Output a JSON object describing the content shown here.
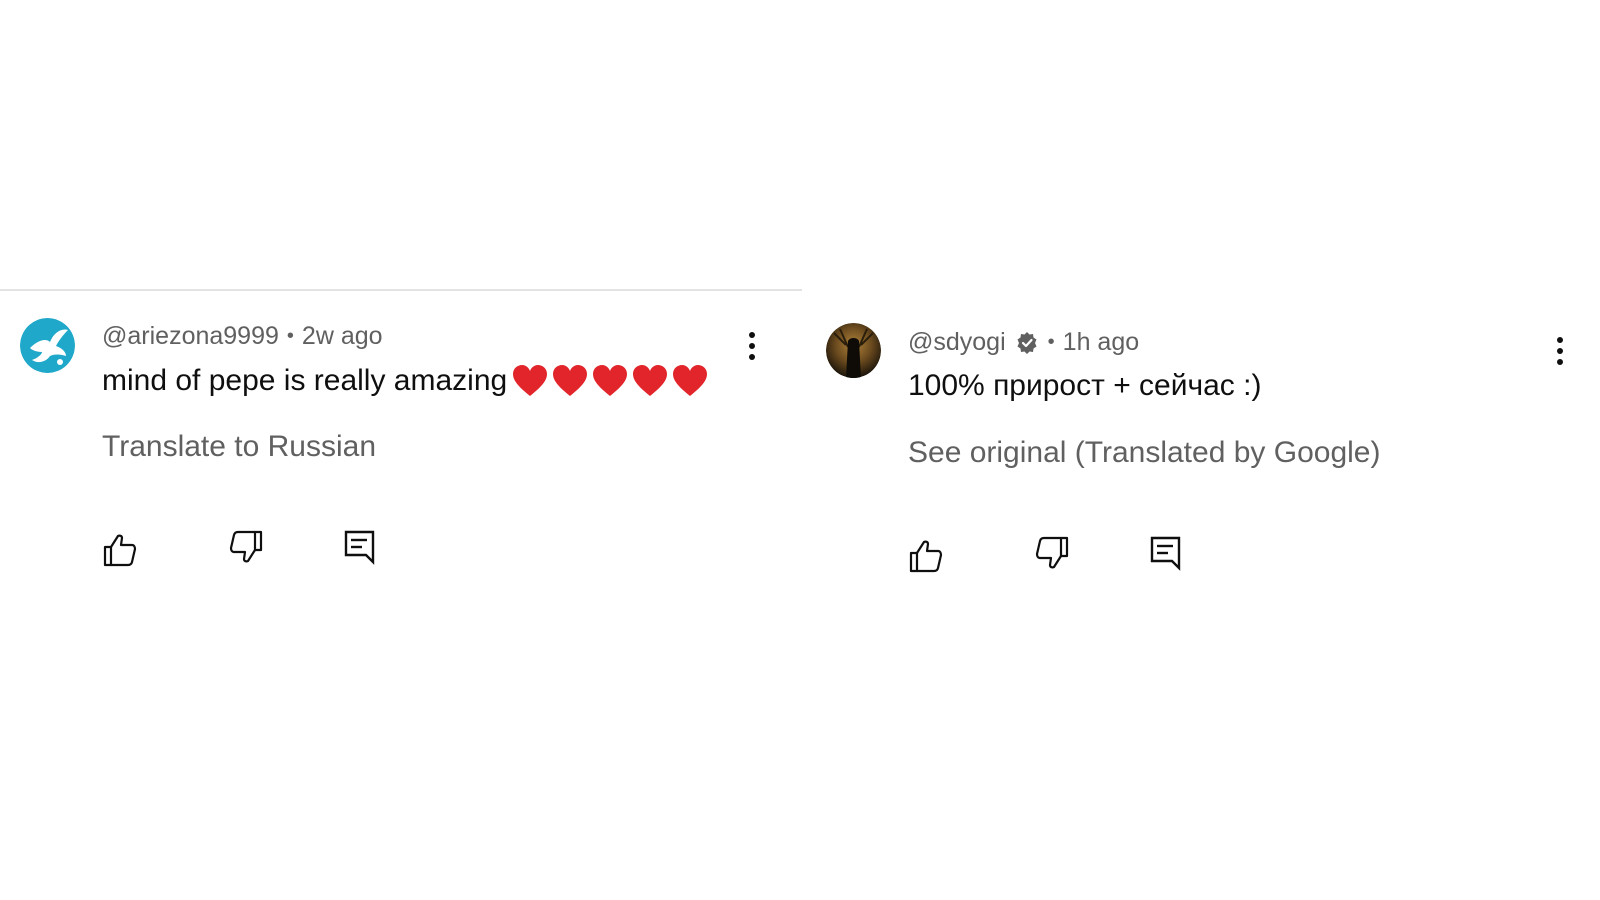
{
  "comments": [
    {
      "author": "@ariezona9999",
      "separator": "•",
      "time": "2w ago",
      "text": "mind of pepe is really amazing",
      "emoji": "❤️❤️❤️❤️❤️",
      "translate_label": "Translate to Russian",
      "avatar_icon": "dove-icon",
      "avatar_color": "#1fa8c9"
    },
    {
      "author": "@sdyogi",
      "separator": "•",
      "time": "1h ago",
      "text": "100% прирост + сейчас :)",
      "translate_label": "See original (Translated by Google)",
      "avatar_icon": "dark-photo-avatar",
      "badge_icon": "verified-gear-icon"
    }
  ],
  "colors": {
    "text_primary": "#0f0f0f",
    "text_secondary": "#606060",
    "heart": "#e1252a",
    "divider": "#e3e3e3"
  }
}
